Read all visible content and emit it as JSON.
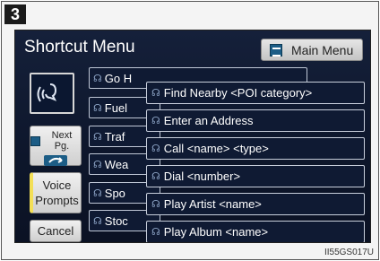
{
  "step_number": "3",
  "screen": {
    "title": "Shortcut Menu",
    "main_menu_label": "Main Menu",
    "left_buttons": {
      "next_page_label": "Next Pg.",
      "voice_prompts_line1": "Voice",
      "voice_prompts_line2": "Prompts",
      "cancel_label": "Cancel"
    },
    "background_list": [
      "Go H",
      "Fuel",
      "Traf",
      "Wea",
      "Spo",
      "Stoc"
    ],
    "command_list": [
      "Find Nearby <POI category>",
      "Enter an Address",
      "Call <name> <type>",
      "Dial <number>",
      "Play Artist <name>",
      "Play Album <name>"
    ]
  },
  "figure_code": "II55GS017U",
  "colors": {
    "screen_bg": "#0d162b",
    "button_gray": "#cfcfcf",
    "voice_accent": "#f3df57",
    "item_border": "#c8cfdc"
  },
  "icons": {
    "voice": "voice-command-icon",
    "main_menu": "menu-icon",
    "next_page": "next-page-arrow-icon",
    "list_bullet": "voice-mic-icon"
  }
}
